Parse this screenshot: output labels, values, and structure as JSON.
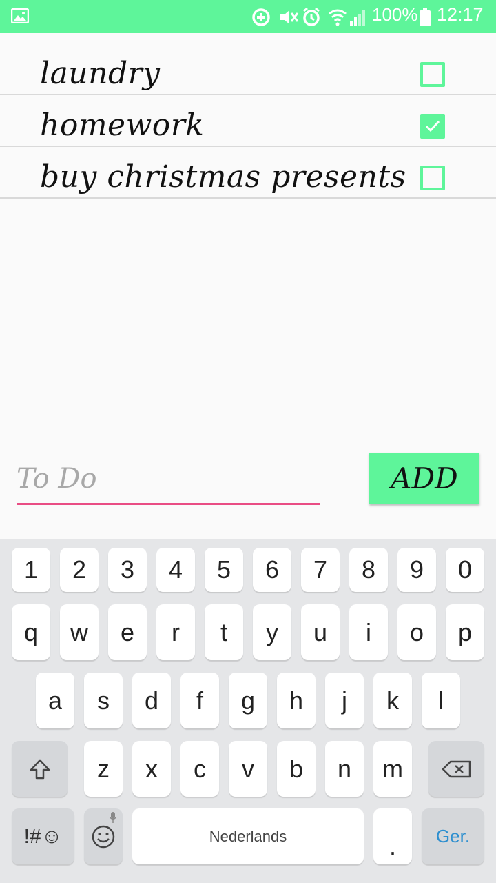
{
  "status_bar": {
    "battery_percent": "100%",
    "time": "12:17",
    "icons": [
      "gallery-icon",
      "data-saver-icon",
      "mute-icon",
      "alarm-icon",
      "wifi-icon",
      "signal-icon",
      "battery-icon"
    ]
  },
  "todos": [
    {
      "text": "laundry",
      "checked": false
    },
    {
      "text": "homework",
      "checked": true
    },
    {
      "text": "buy christmas presents",
      "checked": false
    }
  ],
  "input": {
    "placeholder": "To Do",
    "value": ""
  },
  "add_button": {
    "label": "ADD"
  },
  "keyboard": {
    "number_row": [
      "1",
      "2",
      "3",
      "4",
      "5",
      "6",
      "7",
      "8",
      "9",
      "0"
    ],
    "row1": [
      "q",
      "w",
      "e",
      "r",
      "t",
      "y",
      "u",
      "i",
      "o",
      "p"
    ],
    "row2": [
      "a",
      "s",
      "d",
      "f",
      "g",
      "h",
      "j",
      "k",
      "l"
    ],
    "row3": [
      "z",
      "x",
      "c",
      "v",
      "b",
      "n",
      "m"
    ],
    "symbols_label": "!#☺",
    "space_label": "Nederlands",
    "period_label": ".",
    "enter_label": "Ger."
  },
  "colors": {
    "accent": "#5ef59a",
    "underline": "#e94d84"
  }
}
